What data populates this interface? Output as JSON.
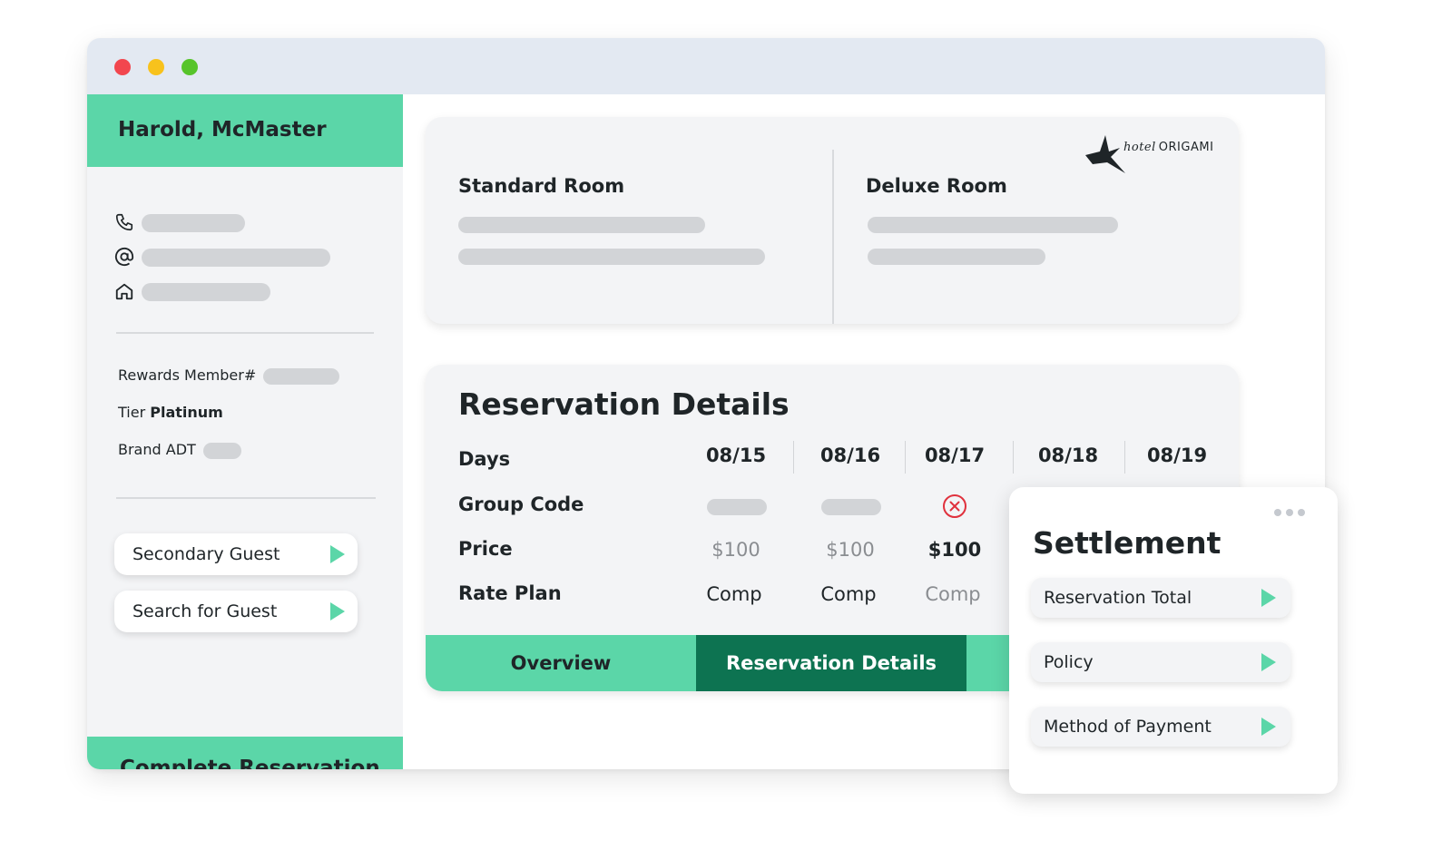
{
  "window": {
    "controls": [
      "close",
      "minimize",
      "maximize"
    ],
    "colors": {
      "close": "#f2464e",
      "minimize": "#f8c21c",
      "maximize": "#57c42b"
    }
  },
  "sidebar": {
    "guest_name": "Harold, McMaster",
    "contacts": [
      {
        "icon": "phone-icon"
      },
      {
        "icon": "at-sign-icon"
      },
      {
        "icon": "home-icon"
      }
    ],
    "rewards_label": "Rewards Member#",
    "tier_label": "Tier",
    "tier_value": "Platinum",
    "brand_label": "Brand ADT",
    "buttons": [
      {
        "label": "Secondary Guest",
        "icon": "play-triangle-icon"
      },
      {
        "label": "Search for Guest",
        "icon": "play-triangle-icon"
      }
    ],
    "complete_label": "Complete Reservation"
  },
  "rooms": {
    "left_title": "Standard Room",
    "right_title": "Deluxe Room",
    "logo_text_script": "hotel",
    "logo_text": "ORIGAMI"
  },
  "reservation": {
    "title": "Reservation Details",
    "row_labels": {
      "days": "Days",
      "group_code": "Group Code",
      "price": "Price",
      "rate_plan": "Rate Plan"
    },
    "dates": [
      "08/15",
      "08/16",
      "08/17",
      "08/18",
      "08/19"
    ],
    "prices": [
      "$100",
      "$100",
      "$100"
    ],
    "rate_plans": [
      "Comp",
      "Comp",
      "Comp"
    ],
    "group_code_status": [
      "redacted",
      "redacted",
      "error"
    ],
    "tabs": [
      "Overview",
      "Reservation Details"
    ],
    "active_tab": "Reservation Details"
  },
  "settlement": {
    "title": "Settlement",
    "items": [
      {
        "label": "Reservation Total",
        "icon": "play-triangle-icon"
      },
      {
        "label": "Policy",
        "icon": "play-triangle-icon"
      },
      {
        "label": "Method of Payment",
        "icon": "play-triangle-icon"
      }
    ]
  },
  "colors": {
    "accent": "#5bd6a8",
    "accent_dark": "#0d7351",
    "error": "#e0313d",
    "panel": "#f3f4f6",
    "placeholder": "#d2d4d7"
  }
}
